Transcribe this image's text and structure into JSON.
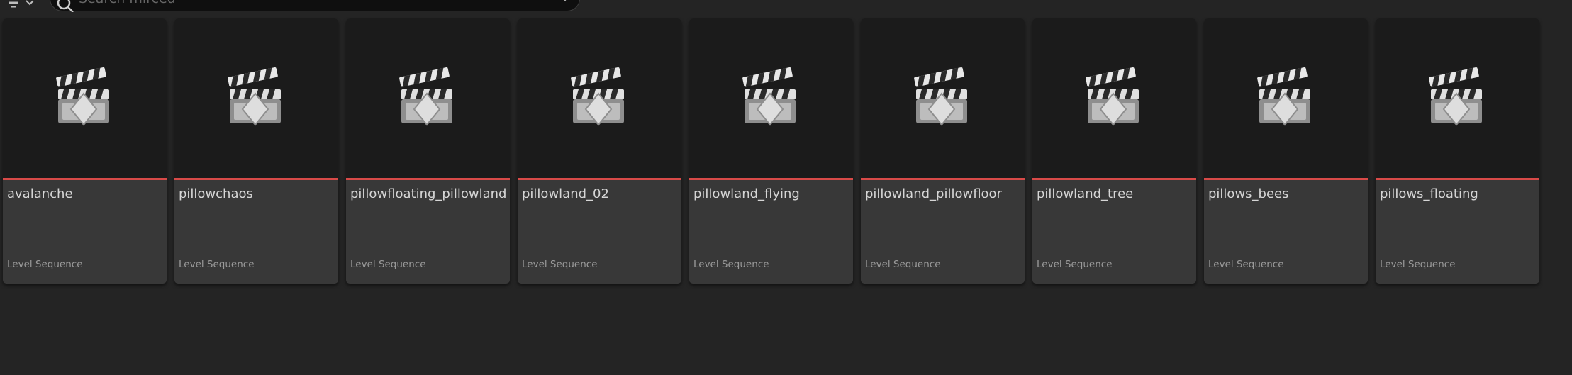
{
  "toolbar": {
    "filter_icon": "filter-icon",
    "search_placeholder": "Search mirced"
  },
  "assets": [
    {
      "name": "avalanche",
      "type": "Level Sequence"
    },
    {
      "name": "pillowchaos",
      "type": "Level Sequence"
    },
    {
      "name": "pillowfloating_pillowland",
      "type": "Level Sequence"
    },
    {
      "name": "pillowland_02",
      "type": "Level Sequence"
    },
    {
      "name": "pillowland_flying",
      "type": "Level Sequence"
    },
    {
      "name": "pillowland_pillowfloor",
      "type": "Level Sequence"
    },
    {
      "name": "pillowland_tree",
      "type": "Level Sequence"
    },
    {
      "name": "pillows_bees",
      "type": "Level Sequence"
    },
    {
      "name": "pillows_floating",
      "type": "Level Sequence"
    }
  ],
  "colors": {
    "background": "#242424",
    "thumbnail_bg": "#1b1b1b",
    "card_bg": "#383838",
    "asset_accent": "#d84a48"
  }
}
